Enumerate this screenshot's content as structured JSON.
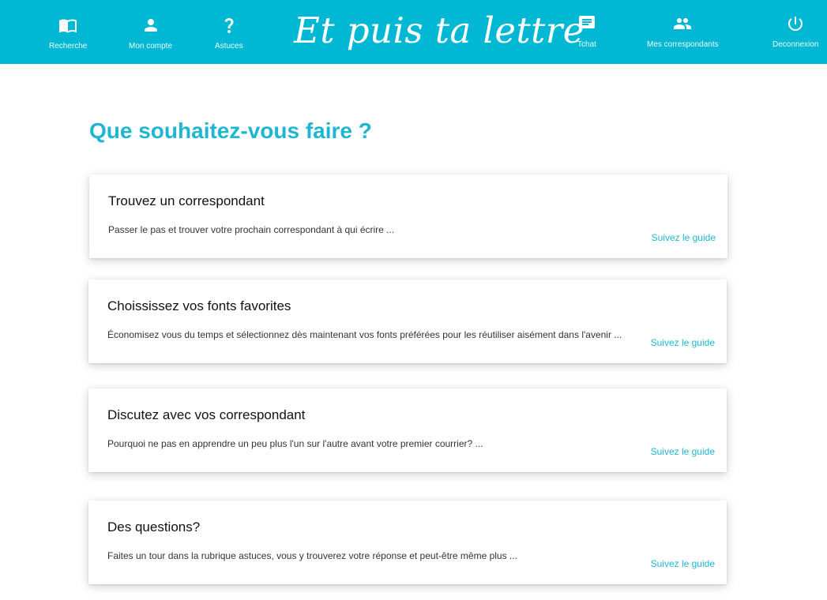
{
  "header": {
    "logo_text": "Et puis ta lettre",
    "bg_color": "#00b8d4",
    "nav_left": [
      {
        "label": "Recherche",
        "icon": "book-map-icon"
      },
      {
        "label": "Mon compte",
        "icon": "person-icon"
      },
      {
        "label": "Astuces",
        "icon": "question-icon"
      }
    ],
    "nav_right": [
      {
        "label": "Tchat",
        "icon": "chat-icon"
      },
      {
        "label": "Mes correspondants",
        "icon": "people-icon"
      },
      {
        "label": "Deconnexion",
        "icon": "power-icon"
      }
    ]
  },
  "main": {
    "title": "Que souhaitez-vous faire ?",
    "accent_color": "#1fb6d1",
    "cards": [
      {
        "title": "Trouvez un correspondant",
        "description": "Passer le pas et trouver votre prochain correspondant à qui écrire ...",
        "link": "Suivez le guide"
      },
      {
        "title": "Choississez vos fonts favorites",
        "description": "Économisez vous du temps et sélectionnez dès maintenant vos fonts préférées pour les réutiliser aisément dans l'avenir ...",
        "link": "Suivez le guide"
      },
      {
        "title": "Discutez avec vos correspondant",
        "description": "Pourquoi ne pas en apprendre un peu plus l'un sur l'autre avant votre premier courrier? ...",
        "link": "Suivez le guide"
      },
      {
        "title": "Des questions?",
        "description": "Faites un tour dans la rubrique astuces, vous y trouverez votre réponse et peut-être même plus ...",
        "link": "Suivez le guide"
      }
    ]
  }
}
